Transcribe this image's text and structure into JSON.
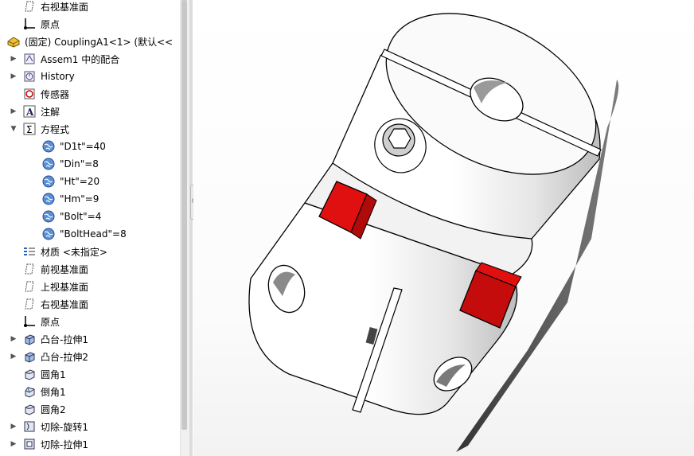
{
  "feature_tree": {
    "items": [
      {
        "label": "右视基准面",
        "icon": "plane-icon",
        "arrow": ""
      },
      {
        "label": "原点",
        "icon": "origin-icon",
        "arrow": ""
      },
      {
        "label": "(固定) CouplingA1<1> (默认<<",
        "icon": "part-icon",
        "arrow": "expanded"
      },
      {
        "label": "Assem1 中的配合",
        "icon": "mates-icon",
        "arrow": "collapsed"
      },
      {
        "label": "History",
        "icon": "history-icon",
        "arrow": "collapsed"
      },
      {
        "label": "传感器",
        "icon": "sensor-icon",
        "arrow": ""
      },
      {
        "label": "注解",
        "icon": "annotation-icon",
        "arrow": "collapsed"
      },
      {
        "label": "方程式",
        "icon": "equation-icon",
        "arrow": "expanded"
      },
      {
        "label": "\"D1t\"=40",
        "icon": "globe-variable-icon",
        "arrow": ""
      },
      {
        "label": "\"Din\"=8",
        "icon": "globe-variable-icon",
        "arrow": ""
      },
      {
        "label": "\"Ht\"=20",
        "icon": "globe-variable-icon",
        "arrow": ""
      },
      {
        "label": "\"Hm\"=9",
        "icon": "globe-variable-icon",
        "arrow": ""
      },
      {
        "label": "\"Bolt\"=4",
        "icon": "globe-variable-icon",
        "arrow": ""
      },
      {
        "label": "\"BoltHead\"=8",
        "icon": "globe-variable-icon",
        "arrow": ""
      },
      {
        "label": "材质 <未指定>",
        "icon": "material-icon",
        "arrow": ""
      },
      {
        "label": "前视基准面",
        "icon": "plane-icon",
        "arrow": ""
      },
      {
        "label": "上视基准面",
        "icon": "plane-icon",
        "arrow": ""
      },
      {
        "label": "右视基准面",
        "icon": "plane-icon",
        "arrow": ""
      },
      {
        "label": "原点",
        "icon": "origin-icon",
        "arrow": ""
      },
      {
        "label": "凸台-拉伸1",
        "icon": "extrude-icon",
        "arrow": "collapsed"
      },
      {
        "label": "凸台-拉伸2",
        "icon": "extrude-icon",
        "arrow": "collapsed"
      },
      {
        "label": "圆角1",
        "icon": "fillet-icon",
        "arrow": ""
      },
      {
        "label": "倒角1",
        "icon": "chamfer-icon",
        "arrow": ""
      },
      {
        "label": "圆角2",
        "icon": "fillet-icon",
        "arrow": ""
      },
      {
        "label": "切除-旋转1",
        "icon": "cut-revolve-icon",
        "arrow": "collapsed"
      },
      {
        "label": "切除-拉伸1",
        "icon": "cut-extrude-icon",
        "arrow": "collapsed"
      }
    ]
  },
  "viewport": {
    "model": "coupling-3d-model",
    "colors": {
      "body": "#ffffff",
      "spider": "#e01010",
      "edge": "#000000",
      "shadow": "#222222"
    }
  }
}
